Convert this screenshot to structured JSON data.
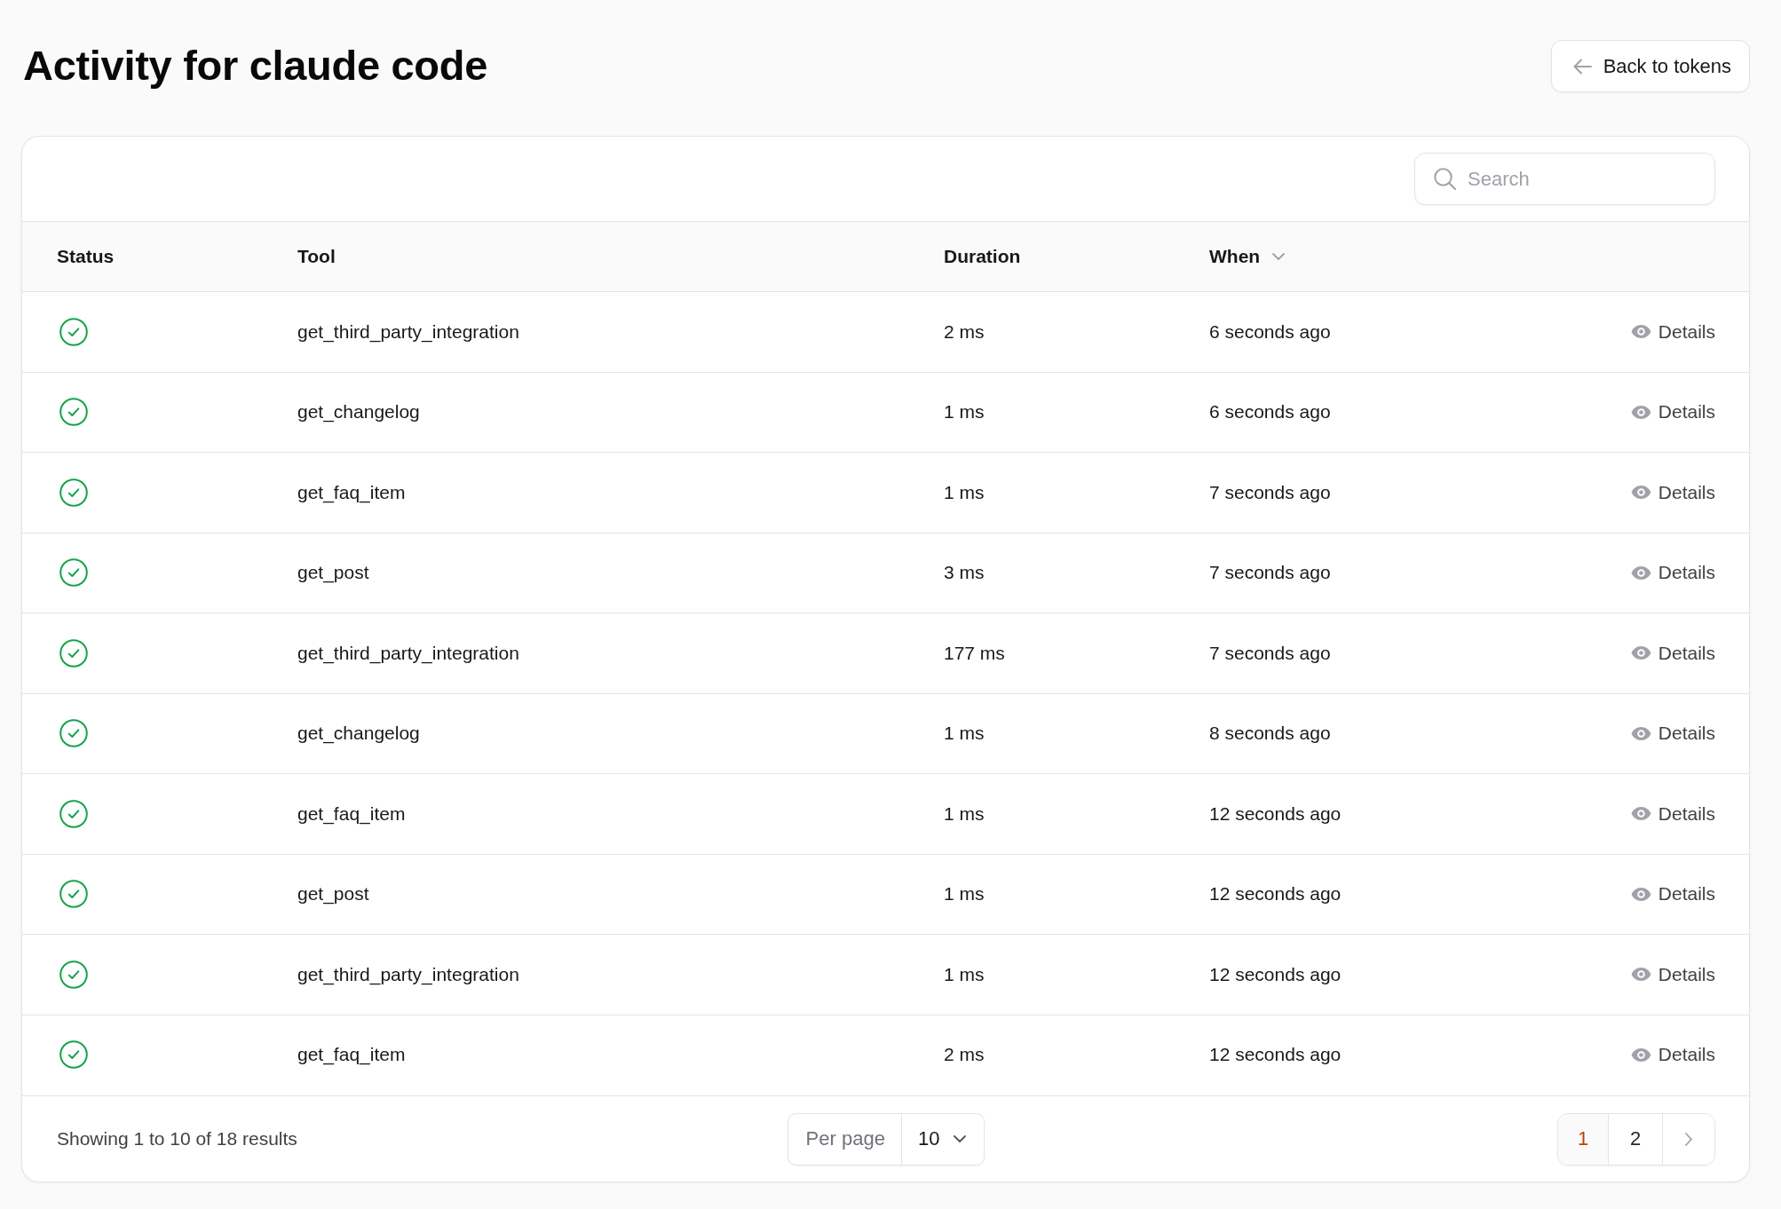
{
  "title": "Activity for claude code",
  "back_button": {
    "label": "Back to tokens"
  },
  "search": {
    "placeholder": "Search"
  },
  "table": {
    "columns": [
      {
        "label": "Status",
        "sorted": false
      },
      {
        "label": "Tool",
        "sorted": false
      },
      {
        "label": "Duration",
        "sorted": false
      },
      {
        "label": "When",
        "sorted": true
      }
    ],
    "rows": [
      {
        "succeeded": true,
        "tool": "get_third_party_integration",
        "duration": "2 ms",
        "when": "6 seconds ago",
        "action": "Details"
      },
      {
        "succeeded": true,
        "tool": "get_changelog",
        "duration": "1 ms",
        "when": "6 seconds ago",
        "action": "Details"
      },
      {
        "succeeded": true,
        "tool": "get_faq_item",
        "duration": "1 ms",
        "when": "7 seconds ago",
        "action": "Details"
      },
      {
        "succeeded": true,
        "tool": "get_post",
        "duration": "3 ms",
        "when": "7 seconds ago",
        "action": "Details"
      },
      {
        "succeeded": true,
        "tool": "get_third_party_integration",
        "duration": "177 ms",
        "when": "7 seconds ago",
        "action": "Details"
      },
      {
        "succeeded": true,
        "tool": "get_changelog",
        "duration": "1 ms",
        "when": "8 seconds ago",
        "action": "Details"
      },
      {
        "succeeded": true,
        "tool": "get_faq_item",
        "duration": "1 ms",
        "when": "12 seconds ago",
        "action": "Details"
      },
      {
        "succeeded": true,
        "tool": "get_post",
        "duration": "1 ms",
        "when": "12 seconds ago",
        "action": "Details"
      },
      {
        "succeeded": true,
        "tool": "get_third_party_integration",
        "duration": "1 ms",
        "when": "12 seconds ago",
        "action": "Details"
      },
      {
        "succeeded": true,
        "tool": "get_faq_item",
        "duration": "2 ms",
        "when": "12 seconds ago",
        "action": "Details"
      }
    ]
  },
  "footer": {
    "summary": "Showing 1 to 10 of 18 results",
    "per_page": {
      "label": "Per page",
      "value": "10"
    },
    "pages": [
      {
        "label": "1",
        "selected": true
      },
      {
        "label": "2",
        "selected": false
      }
    ]
  }
}
